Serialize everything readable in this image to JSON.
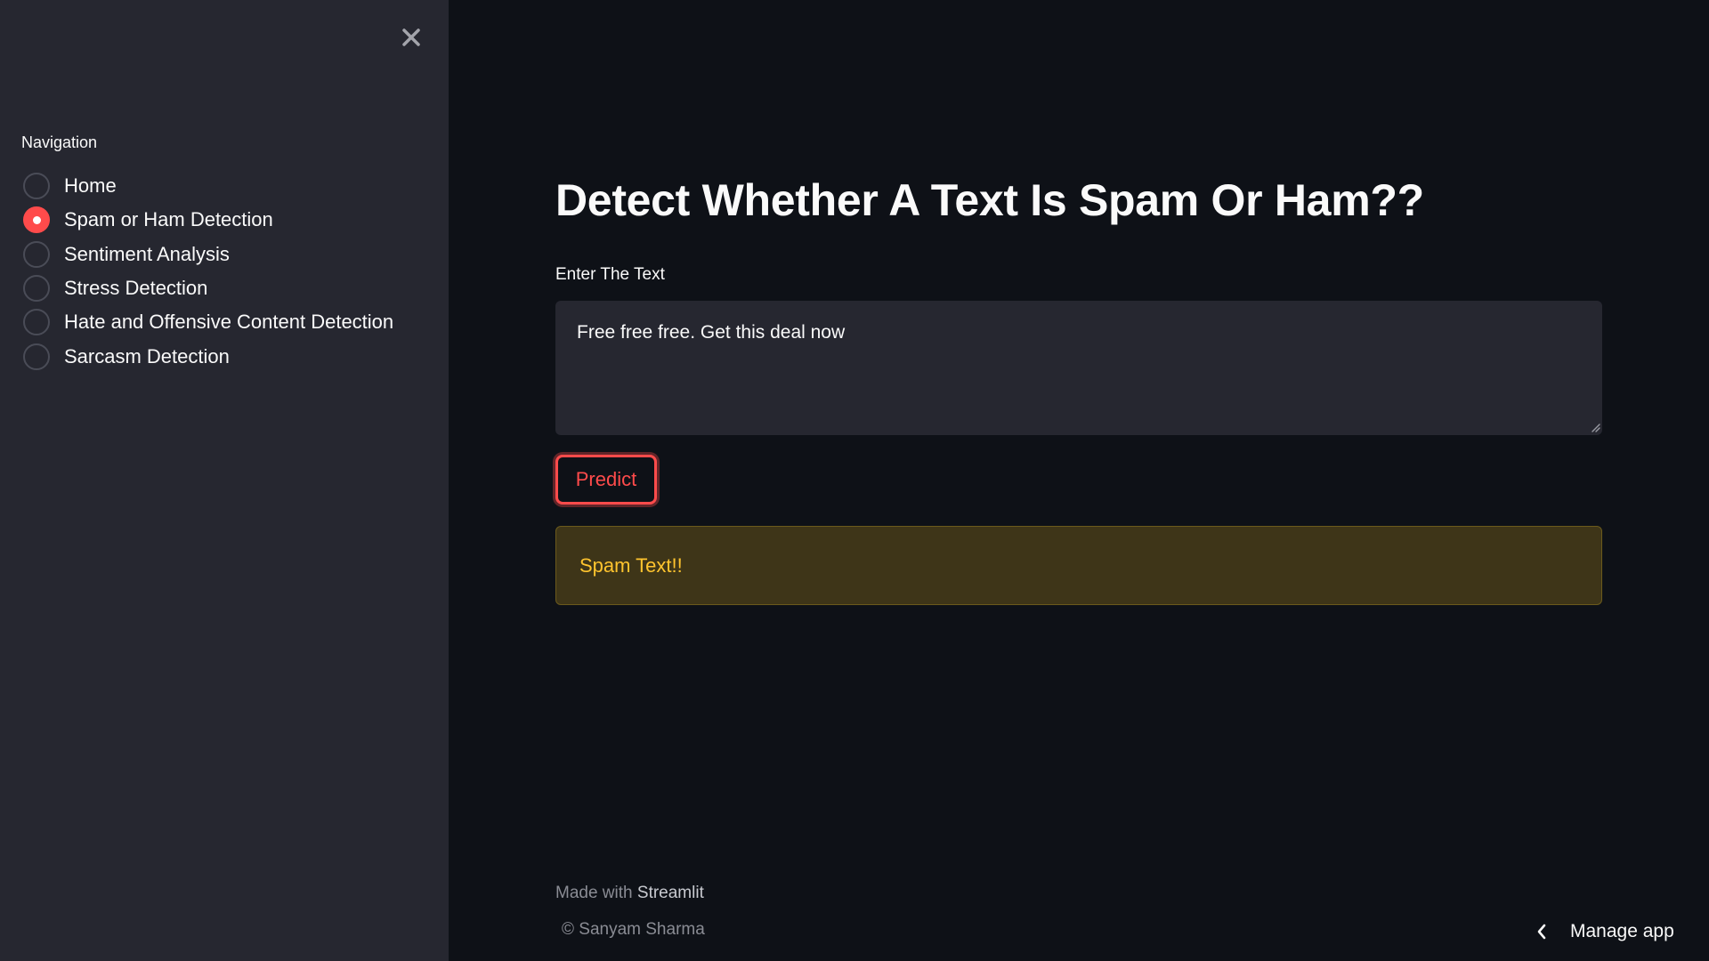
{
  "sidebar": {
    "close_icon": "close-icon",
    "nav_label": "Navigation",
    "items": [
      {
        "label": "Home",
        "selected": false
      },
      {
        "label": "Spam or Ham Detection",
        "selected": true
      },
      {
        "label": "Sentiment Analysis",
        "selected": false
      },
      {
        "label": "Stress Detection",
        "selected": false
      },
      {
        "label": "Hate and Offensive Content Detection",
        "selected": false
      },
      {
        "label": "Sarcasm Detection",
        "selected": false
      }
    ]
  },
  "main": {
    "title": "Detect Whether A Text Is Spam Or Ham??",
    "input_label": "Enter The Text",
    "input_value": "Free free free. Get this deal now",
    "predict_label": "Predict",
    "result_text": "Spam Text!!"
  },
  "footer": {
    "made_with": "Made with",
    "brand": "Streamlit",
    "copyright": "© Sanyam Sharma"
  },
  "manage_app": {
    "label": "Manage app",
    "icon": "chevron-left-icon"
  },
  "colors": {
    "accent": "#ff4b4b",
    "background": "#0e1117",
    "sidebar": "#262730",
    "warning_bg": "#3e3518",
    "warning_text": "#ffc42e"
  }
}
